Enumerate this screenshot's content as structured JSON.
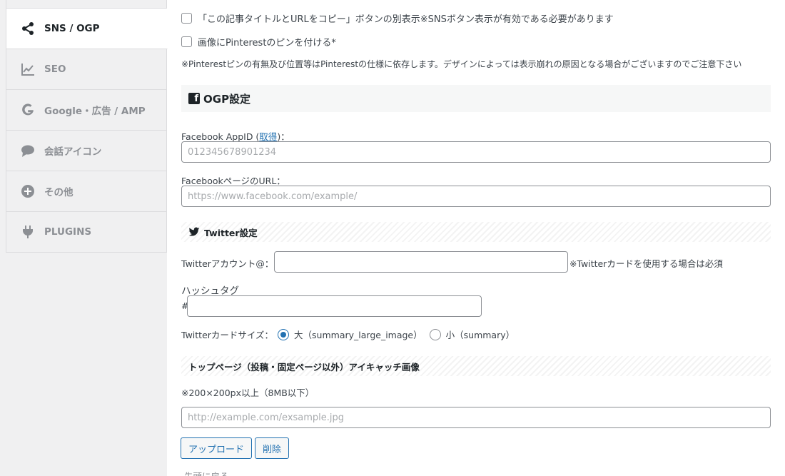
{
  "sidebar": {
    "items": [
      {
        "label": "SNS / OGP",
        "icon": "share-icon"
      },
      {
        "label": "SEO",
        "icon": "chart-line-icon"
      },
      {
        "label": "Google・広告 / AMP",
        "icon": "google-icon"
      },
      {
        "label": "会話アイコン",
        "icon": "speech-bubble-icon"
      },
      {
        "label": "その他",
        "icon": "plus-circle-icon"
      },
      {
        "label": "PLUGINS",
        "icon": "plug-icon"
      }
    ]
  },
  "sns": {
    "copy_button_option": "「この記事タイトルとURLをコピー」ボタンの別表示※SNSボタン表示が有効である必要があります",
    "pinterest_option": "画像にPinterestのピンを付ける*",
    "pinterest_note": "※Pinterestピンの有無及び位置等はPinterestの仕様に依存します。デザインによっては表示崩れの原因となる場合がございますのでご注意下さい"
  },
  "ogp": {
    "heading": "OGP設定",
    "fb_appid_label_prefix": "Facebook AppID (",
    "fb_appid_link": "取得",
    "fb_appid_label_suffix": ")：",
    "fb_appid_placeholder": "012345678901234",
    "fb_page_label": "FacebookページのURL：",
    "fb_page_placeholder": "https://www.facebook.com/example/"
  },
  "twitter": {
    "heading": "Twitter設定",
    "account_label": "Twitterアカウント@：",
    "account_value": "",
    "account_note": "※Twitterカードを使用する場合は必須",
    "hashtag_label": "ハッシュタグ",
    "hashtag_prefix": "#",
    "hashtag_value": "",
    "card_size_label": "Twitterカードサイズ：",
    "card_large": "大（summary_large_image）",
    "card_small": "小（summary）",
    "card_selected": "large"
  },
  "eyecatch": {
    "heading": "トップページ（投稿・固定ページ以外）アイキャッチ画像",
    "size_note": "※200×200px以上（8MB以下）",
    "url_placeholder": "http://example.com/exsample.jpg",
    "upload_label": "アップロード",
    "delete_label": "削除"
  },
  "footer": {
    "back_to_top": "先頭に戻る"
  },
  "colors": {
    "accent": "#2271b1",
    "text": "#3c434a",
    "sidebar_bg": "#f0f0f1"
  }
}
